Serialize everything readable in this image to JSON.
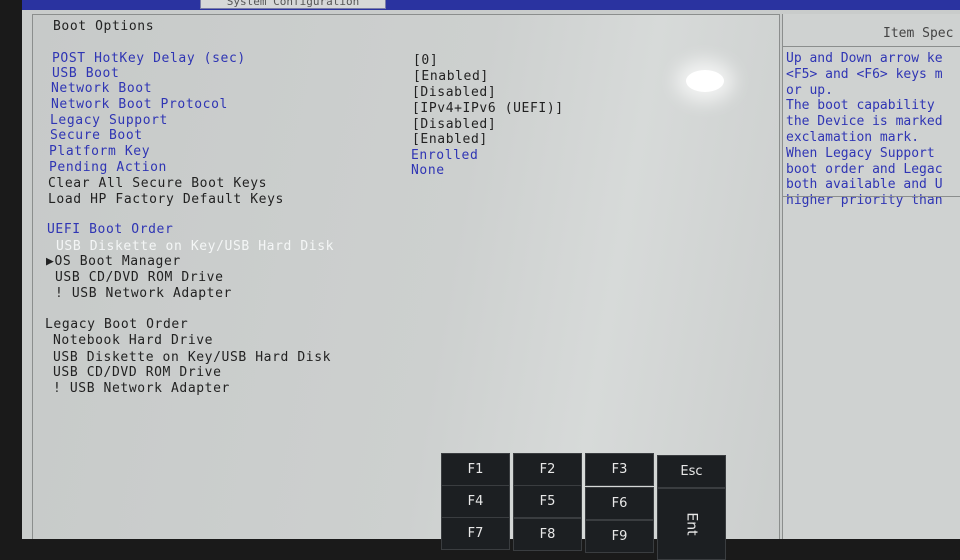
{
  "tabs": {
    "active": "System Configuration"
  },
  "section_title": "Boot Options",
  "settings": [
    {
      "label": "POST HotKey Delay (sec)",
      "value": "[0]"
    },
    {
      "label": "USB Boot",
      "value": "[Enabled]"
    },
    {
      "label": "Network Boot",
      "value": "[Disabled]"
    },
    {
      "label": "Network Boot Protocol",
      "value": "[IPv4+IPv6 (UEFI)]"
    },
    {
      "label": "Legacy Support",
      "value": "[Disabled]"
    },
    {
      "label": "Secure Boot",
      "value": "[Enabled]"
    },
    {
      "label": "Platform Key",
      "value": "Enrolled"
    },
    {
      "label": "Pending Action",
      "value": "None"
    }
  ],
  "actions": [
    "Clear All Secure Boot Keys",
    "Load HP Factory Default Keys"
  ],
  "uefi_boot_order": {
    "title": "UEFI Boot Order",
    "items": [
      "USB Diskette on Key/USB Hard Disk",
      "OS Boot Manager",
      "USB CD/DVD ROM Drive",
      "! USB Network Adapter"
    ],
    "selected_marker": "▶"
  },
  "legacy_boot_order": {
    "title": "Legacy Boot Order",
    "items": [
      "Notebook Hard Drive",
      "USB Diskette on Key/USB Hard Disk",
      "USB CD/DVD ROM Drive",
      "! USB Network Adapter"
    ]
  },
  "side_panel": {
    "title": "Item Spec",
    "help_lines": [
      "Up and Down arrow ke",
      "<F5> and <F6> keys m",
      "or up.",
      "The boot capability",
      "the Device is marked",
      "exclamation mark.",
      "When Legacy Support",
      "boot order and Legac",
      "both available and U",
      "higher priority than"
    ]
  },
  "keypad": {
    "f1": "F1",
    "f2": "F2",
    "f3": "F3",
    "esc": "Esc",
    "f4": "F4",
    "f5": "F5",
    "f6": "F6",
    "enter": "Ent",
    "f7": "F7",
    "f8": "F8",
    "f9": "F9"
  },
  "colors": {
    "topbar": "#2a33a0",
    "label_blue": "#2f35b4",
    "panel": "#c9cccb",
    "key": "#1c1f22"
  }
}
